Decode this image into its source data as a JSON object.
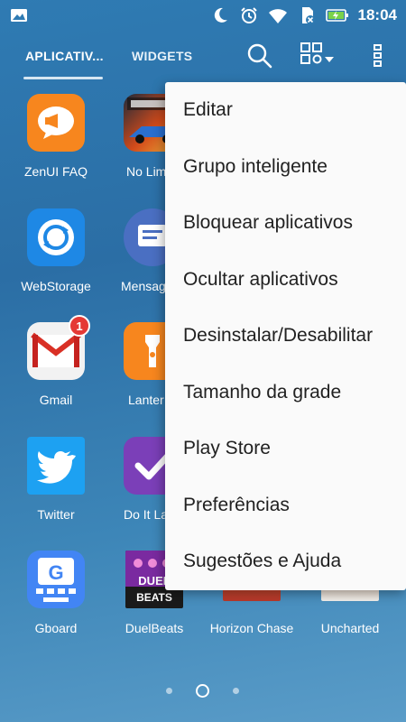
{
  "status_bar": {
    "time": "18:04",
    "icons": [
      "image-icon",
      "moon-icon",
      "alarm-icon",
      "wifi-icon",
      "no-sim-icon",
      "battery-charging-icon"
    ]
  },
  "tabs": {
    "apps": "APLICATIV...",
    "widgets": "WIDGETS"
  },
  "toolbar_icons": [
    "search-icon",
    "grid-settings-icon",
    "more-vert-icon"
  ],
  "apps": [
    {
      "label": "ZenUI FAQ",
      "icon": "zenui-faq-icon"
    },
    {
      "label": "No Lim",
      "icon": "need-for-speed-icon"
    },
    {
      "label": "WebStorage",
      "icon": "webstorage-icon"
    },
    {
      "label": "Mensag",
      "icon": "messages-icon"
    },
    {
      "label": "Gmail",
      "icon": "gmail-icon",
      "badge": "1"
    },
    {
      "label": "Lanter",
      "icon": "flashlight-icon"
    },
    {
      "label": "Twitter",
      "icon": "twitter-icon"
    },
    {
      "label": "Do It La",
      "icon": "do-it-later-icon"
    },
    {
      "label": "Gboard",
      "icon": "gboard-icon"
    },
    {
      "label": "DuelBeats",
      "icon": "duelbeats-icon",
      "icon_text": [
        "DUEL",
        "BEATS"
      ]
    },
    {
      "label": "Horizon Chase",
      "icon": "horizon-chase-icon"
    },
    {
      "label": "Uncharted",
      "icon": "uncharted-icon"
    }
  ],
  "menu": {
    "items": [
      "Editar",
      "Grupo inteligente",
      "Bloquear aplicativos",
      "Ocultar aplicativos",
      "Desinstalar/Desabilitar",
      "Tamanho da grade",
      "Play Store",
      "Preferências",
      "Sugestões e Ajuda"
    ]
  },
  "pager": {
    "pages": 3,
    "active_page": 2
  },
  "colors": {
    "accent": "#2b6ea5",
    "menu_bg": "#fafafa",
    "menu_text": "#212121"
  }
}
